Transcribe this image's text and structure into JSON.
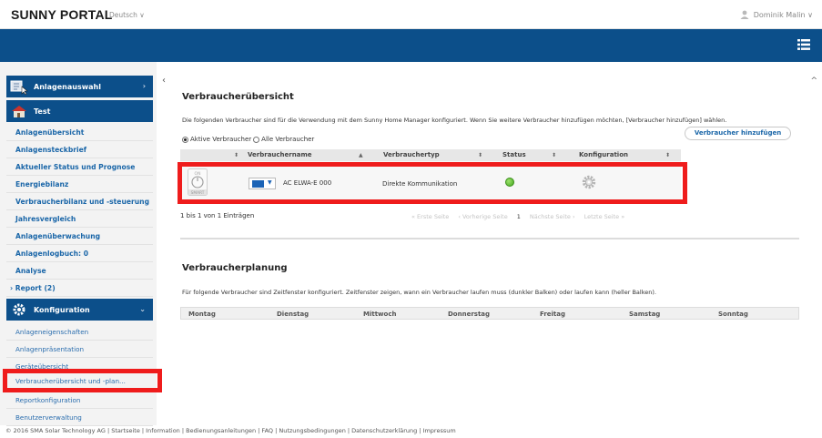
{
  "header": {
    "logo": "SUNNY PORTAL",
    "language": "Deutsch ∨",
    "user": "Dominik Malin ∨"
  },
  "sidebar": {
    "plant_select": "Anlagenauswahl",
    "plant_name": "Test",
    "items": [
      "Anlagenübersicht",
      "Anlagensteckbrief",
      "Aktueller Status und Prognose",
      "Energiebilanz",
      "Verbraucherbilanz und -steuerung",
      "Jahresvergleich",
      "Anlagenüberwachung",
      "Anlagenlogbuch: 0",
      "Analyse",
      "› Report (2)"
    ],
    "config_header": "Konfiguration",
    "config_items": [
      "Anlageneigenschaften",
      "Anlagenpräsentation",
      "Geräteübersicht",
      "Verbraucherübersicht und -plan...",
      "Reportkonfiguration",
      "Benutzerverwaltung"
    ]
  },
  "main": {
    "title": "Verbraucherübersicht",
    "description": "Die folgenden Verbraucher sind für die Verwendung mit dem Sunny Home Manager konfiguriert. Wenn Sie weitere Verbraucher hinzufügen möchten, [Verbraucher hinzufügen] wählen.",
    "add_button": "Verbraucher hinzufügen",
    "radio_active": "Aktive Verbraucher",
    "radio_all": "Alle Verbraucher",
    "columns": [
      "Verbrauchername",
      "Verbrauchertyp",
      "Status",
      "Konfiguration"
    ],
    "row": {
      "icon_on": "ON",
      "icon_smart": "SMART",
      "name": "AC ELWA-E 000",
      "type": "Direkte Kommunikation"
    },
    "entries": "1 bis 1 von 1 Einträgen",
    "pager": [
      "« Erste Seite",
      "‹ Vorherige Seite",
      "1",
      "Nächste Seite ›",
      "Letzte Seite »"
    ],
    "planning_title": "Verbraucherplanung",
    "planning_desc": "Für folgende Verbraucher sind Zeitfenster konfiguriert. Zeitfenster zeigen, wann ein Verbraucher laufen muss (dunkler Balken) oder laufen kann (heller Balken).",
    "days": [
      "Montag",
      "Dienstag",
      "Mittwoch",
      "Donnerstag",
      "Freitag",
      "Samstag",
      "Sonntag"
    ]
  },
  "footer": "© 2016 SMA Solar Technology AG  |  Startseite  |  Information  |  Bedienungsanleitungen  |  FAQ  |  Nutzungsbedingungen  |  Datenschutzerklärung  |  Impressum",
  "colors": {
    "band": "#0c4f8a",
    "highlight": "#ef1c1c",
    "link": "#1a66a8",
    "status_ok": "#46a81e"
  }
}
